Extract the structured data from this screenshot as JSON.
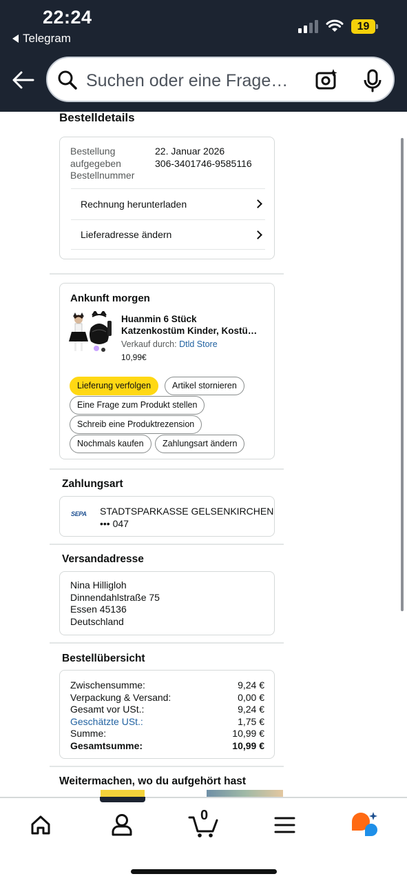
{
  "status_bar": {
    "time": "22:24",
    "back_app": "Telegram",
    "battery": "19"
  },
  "search": {
    "placeholder": "Suchen oder eine Frage…",
    "icons": [
      "back-arrow-icon",
      "search-icon",
      "camera-sparkle-icon",
      "microphone-icon"
    ]
  },
  "order_details": {
    "title": "Bestelldetails",
    "placed_label": "Bestellung aufgegeben",
    "placed_value": "22. Januar 2026",
    "number_label": "Bestellnummer",
    "number_value": "306-3401746-9585116",
    "invoice_link": "Rechnung herunterladen",
    "address_link": "Lieferadresse ändern"
  },
  "shipment": {
    "heading": "Ankunft morgen",
    "product_title_line1": "Huanmin 6 Stück",
    "product_title_line2": "Katzenkostüm Kinder, Kostü…",
    "sold_by_label": "Verkauf durch:",
    "seller": "Dtld Store",
    "price": "10,99€",
    "actions": {
      "track": "Lieferung verfolgen",
      "cancel": "Artikel stornieren",
      "ask": "Eine Frage zum Produkt stellen",
      "review": "Schreib eine Produktrezension",
      "rebuy": "Nochmals kaufen",
      "payment": "Zahlungsart ändern"
    }
  },
  "payment": {
    "title": "Zahlungsart",
    "logo_text": "SEPA",
    "bank": "STADTSPARKASSE GELSENKIRCHEN",
    "account": "••• 047"
  },
  "shipping_address": {
    "title": "Versandadresse",
    "name": "Nina Hilligloh",
    "street": "Dinnendahlstraße 75",
    "city": "Essen 45136",
    "country": "Deutschland"
  },
  "summary": {
    "title": "Bestellübersicht",
    "rows": [
      {
        "label": "Zwischensumme:",
        "value": "9,24 €"
      },
      {
        "label": "Verpackung & Versand:",
        "value": "0,00 €"
      },
      {
        "label": "Gesamt vor USt.:",
        "value": "9,24 €"
      },
      {
        "label": "Geschätzte USt.:",
        "value": "1,75 €"
      },
      {
        "label": "Summe:",
        "value": "10,99 €"
      },
      {
        "label": "Gesamtsumme:",
        "value": "10,99 €"
      }
    ]
  },
  "continue": {
    "title": "Weitermachen, wo du aufgehört hast"
  },
  "bottom_nav": {
    "cart_count": "0",
    "items": [
      "home-icon",
      "account-icon",
      "cart-icon",
      "menu-icon",
      "rufus-assistant-icon"
    ]
  },
  "colors": {
    "header_bg": "#1c2431",
    "primary_button": "#ffd814",
    "link": "#2162a1",
    "battery": "#f5d10a"
  }
}
